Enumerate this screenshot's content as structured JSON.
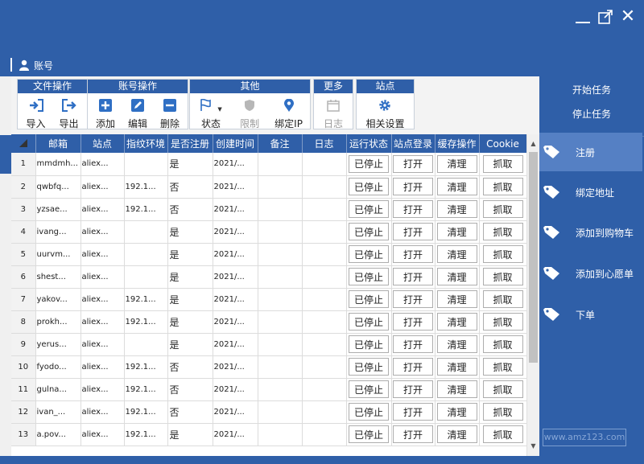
{
  "account_bar": {
    "label": "账号"
  },
  "toolbar": {
    "groups": [
      {
        "title": "文件操作",
        "buttons": [
          {
            "label": "导入"
          },
          {
            "label": "导出"
          }
        ]
      },
      {
        "title": "账号操作",
        "buttons": [
          {
            "label": "添加"
          },
          {
            "label": "编辑"
          },
          {
            "label": "删除"
          }
        ]
      },
      {
        "title": "其他",
        "buttons": [
          {
            "label": "状态"
          },
          {
            "label": "限制"
          },
          {
            "label": "绑定IP"
          }
        ]
      },
      {
        "title": "更多",
        "buttons": [
          {
            "label": "日志"
          }
        ]
      },
      {
        "title": "站点",
        "buttons": [
          {
            "label": "相关设置"
          }
        ]
      }
    ]
  },
  "table": {
    "columns": [
      "邮箱",
      "站点",
      "指纹环境",
      "是否注册",
      "创建时间",
      "备注",
      "日志",
      "运行状态",
      "站点登录",
      "缓存操作",
      "Cookie"
    ],
    "rows": [
      {
        "n": "1",
        "email": "mmdmh...",
        "site": "aliex...",
        "env": "",
        "reg": "是",
        "time": "2021/...",
        "status": "已停止",
        "login": "打开",
        "cache": "清理",
        "cookie": "抓取"
      },
      {
        "n": "2",
        "email": "qwbfq...",
        "site": "aliex...",
        "env": "192.1...",
        "reg": "否",
        "time": "2021/...",
        "status": "已停止",
        "login": "打开",
        "cache": "清理",
        "cookie": "抓取"
      },
      {
        "n": "3",
        "email": "yzsae...",
        "site": "aliex...",
        "env": "192.1...",
        "reg": "否",
        "time": "2021/...",
        "status": "已停止",
        "login": "打开",
        "cache": "清理",
        "cookie": "抓取"
      },
      {
        "n": "4",
        "email": "ivang...",
        "site": "aliex...",
        "env": "",
        "reg": "是",
        "time": "2021/...",
        "status": "已停止",
        "login": "打开",
        "cache": "清理",
        "cookie": "抓取"
      },
      {
        "n": "5",
        "email": "uurvm...",
        "site": "aliex...",
        "env": "",
        "reg": "是",
        "time": "2021/...",
        "status": "已停止",
        "login": "打开",
        "cache": "清理",
        "cookie": "抓取"
      },
      {
        "n": "6",
        "email": "shest...",
        "site": "aliex...",
        "env": "",
        "reg": "是",
        "time": "2021/...",
        "status": "已停止",
        "login": "打开",
        "cache": "清理",
        "cookie": "抓取"
      },
      {
        "n": "7",
        "email": "yakov...",
        "site": "aliex...",
        "env": "192.1...",
        "reg": "是",
        "time": "2021/...",
        "status": "已停止",
        "login": "打开",
        "cache": "清理",
        "cookie": "抓取"
      },
      {
        "n": "8",
        "email": "prokh...",
        "site": "aliex...",
        "env": "192.1...",
        "reg": "是",
        "time": "2021/...",
        "status": "已停止",
        "login": "打开",
        "cache": "清理",
        "cookie": "抓取"
      },
      {
        "n": "9",
        "email": "yerus...",
        "site": "aliex...",
        "env": "",
        "reg": "是",
        "time": "2021/...",
        "status": "已停止",
        "login": "打开",
        "cache": "清理",
        "cookie": "抓取"
      },
      {
        "n": "10",
        "email": "fyodo...",
        "site": "aliex...",
        "env": "192.1...",
        "reg": "否",
        "time": "2021/...",
        "status": "已停止",
        "login": "打开",
        "cache": "清理",
        "cookie": "抓取"
      },
      {
        "n": "11",
        "email": "gulna...",
        "site": "aliex...",
        "env": "192.1...",
        "reg": "否",
        "time": "2021/...",
        "status": "已停止",
        "login": "打开",
        "cache": "清理",
        "cookie": "抓取"
      },
      {
        "n": "12",
        "email": "ivan_...",
        "site": "aliex...",
        "env": "192.1...",
        "reg": "否",
        "time": "2021/...",
        "status": "已停止",
        "login": "打开",
        "cache": "清理",
        "cookie": "抓取"
      },
      {
        "n": "13",
        "email": "a.pov...",
        "site": "aliex...",
        "env": "192.1...",
        "reg": "是",
        "time": "2021/...",
        "status": "已停止",
        "login": "打开",
        "cache": "清理",
        "cookie": "抓取"
      }
    ]
  },
  "sidebar": {
    "tasks": [
      {
        "label": "开始任务"
      },
      {
        "label": "停止任务"
      }
    ],
    "items": [
      {
        "label": "注册",
        "active": true
      },
      {
        "label": "绑定地址",
        "active": false
      },
      {
        "label": "添加到购物车",
        "active": false
      },
      {
        "label": "添加到心愿单",
        "active": false
      },
      {
        "label": "下单",
        "active": false
      }
    ]
  },
  "watermark": "www.amz123.com",
  "colors": {
    "primary": "#2f5fa8",
    "active": "#5580c4",
    "icon_blue": "#2f6fc4"
  }
}
